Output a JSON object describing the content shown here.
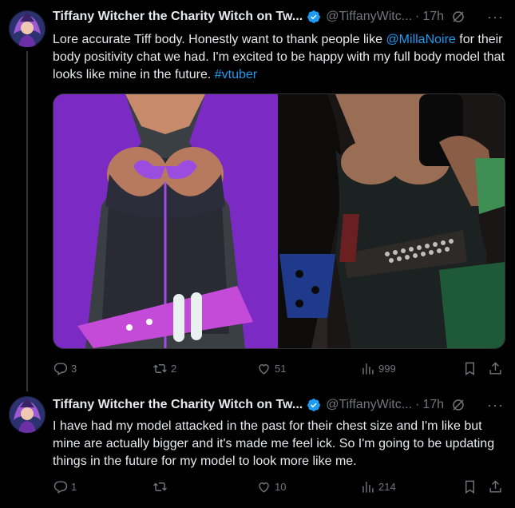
{
  "tweets": [
    {
      "name": "Tiffany Witcher the Charity Witch on Tw...",
      "handle": "@TiffanyWitc...",
      "time": "17h",
      "text_before": "Lore accurate Tiff body. Honestly want to thank people like ",
      "mention": "@MillaNoire",
      "text_middle": " for their body positivity chat we had. I'm excited to be happy with my full body model that looks like mine in the future. ",
      "hashtag": "#vtuber",
      "replies": "3",
      "reposts": "2",
      "likes": "51",
      "views": "999"
    },
    {
      "name": "Tiffany Witcher the Charity Witch on Tw...",
      "handle": "@TiffanyWitc...",
      "time": "17h",
      "text": "I have had my model attacked in the past for their chest size and I'm like but mine are actually bigger and it's made me feel ick. So I'm going to be updating things in the future for my model to look more like me.",
      "replies": "1",
      "reposts": "",
      "likes": "10",
      "views": "214"
    }
  ],
  "icons": {
    "verified": "verified-badge-icon",
    "grok": "grok-icon",
    "more": "more-icon",
    "reply": "reply-icon",
    "repost": "repost-icon",
    "like": "like-icon",
    "views": "views-icon",
    "bookmark": "bookmark-icon",
    "share": "share-icon"
  },
  "colors": {
    "background": "#000000",
    "text": "#e7e9ea",
    "muted": "#71767b",
    "link": "#1d9bf0",
    "verified": "#1d9bf0"
  }
}
